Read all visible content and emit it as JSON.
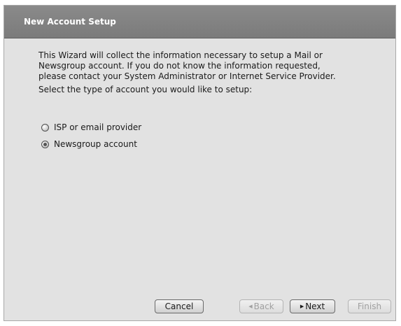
{
  "window": {
    "title": "New Account Setup"
  },
  "intro": {
    "text": "This Wizard will collect the information necessary to setup a Mail or\nNewsgroup account. If you do not know the information requested,\nplease contact your System Administrator or Internet Service Provider.",
    "prompt": "Select the type of account you would like to setup:"
  },
  "account_types": [
    {
      "label": "ISP or email provider",
      "selected": false
    },
    {
      "label": "Newsgroup account",
      "selected": true
    }
  ],
  "buttons": {
    "cancel": "Cancel",
    "back": "Back",
    "next": "Next",
    "finish": "Finish"
  },
  "colors": {
    "titlebar": "#808080",
    "background": "#e2e2e2",
    "disabled_text": "#a0a0a0"
  }
}
